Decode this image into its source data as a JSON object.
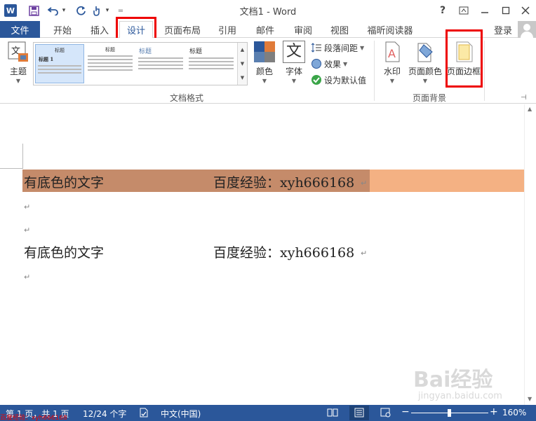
{
  "window": {
    "title": "文档1 - Word",
    "help": "?",
    "login": "登录"
  },
  "quick_access": {
    "undo_caret": "▾",
    "redo_caret": "▾",
    "customize": "="
  },
  "tabs": [
    {
      "label": "文件"
    },
    {
      "label": "开始"
    },
    {
      "label": "插入"
    },
    {
      "label": "设计"
    },
    {
      "label": "页面布局"
    },
    {
      "label": "引用"
    },
    {
      "label": "邮件"
    },
    {
      "label": "审阅"
    },
    {
      "label": "视图"
    },
    {
      "label": "福昕阅读器"
    }
  ],
  "ribbon": {
    "theme_label": "主题",
    "gallery": [
      {
        "heading": "标题",
        "sub": "标题 1"
      },
      {
        "heading": "标题",
        "sub": ""
      },
      {
        "heading": "标题",
        "sub": ""
      },
      {
        "heading": "标题",
        "sub": ""
      }
    ],
    "colors_label": "颜色",
    "fonts_label": "字体",
    "fonts_glyph": "文",
    "para_spacing_label": "段落间距",
    "effects_label": "效果",
    "set_default_label": "设为默认值",
    "doc_format_group": "文档格式",
    "watermark_label": "水印",
    "page_color_label": "页面颜色",
    "page_border_label": "页面边框",
    "page_bg_group": "页面背景",
    "colors": {
      "c1": "#2b579a",
      "c2": "#e07b39",
      "c3": "#5a7fb0",
      "c4": "#7f7f7f"
    }
  },
  "document": {
    "line1_left": "有底色的文字",
    "line1_right": "百度经验：xyh666168",
    "line2_left": "有底色的文字",
    "line2_right": "百度经验：xyh666168",
    "para_mark": "↵",
    "highlight_colors": {
      "outer": "#f4b183",
      "inner": "#c58b6a"
    }
  },
  "status": {
    "page": "第 1 页，共 1 页",
    "words": "12/24 个字",
    "language": "中文(中国)",
    "zoom": "160%"
  },
  "watermark": {
    "brand": "Bai经验",
    "site": "jingyan.baidu.com",
    "red_tag": "百度经验：xyh666168"
  }
}
